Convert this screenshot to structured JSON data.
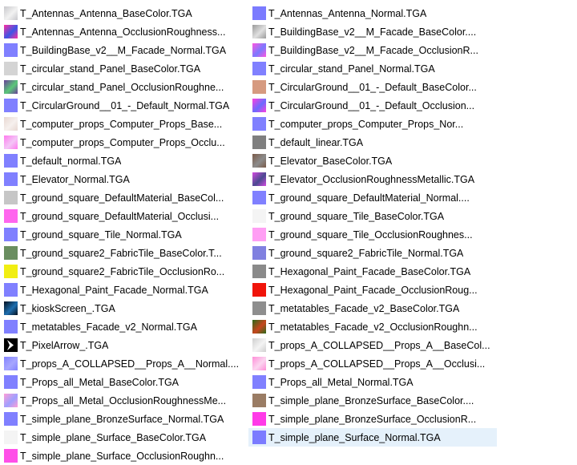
{
  "files": [
    {
      "name": "T_Antennas_Antenna_BaseColor.TGA",
      "thumb": {
        "kind": "mixed",
        "a": "#c8c8cc",
        "b": "#f2f2f2"
      }
    },
    {
      "name": "T_Antennas_Antenna_OcclusionRoughness...",
      "thumb": {
        "kind": "mixed",
        "a": "#ff2fa0",
        "b": "#3b55e6"
      }
    },
    {
      "name": "T_BuildingBase_v2__M_Facade_Normal.TGA",
      "thumb": {
        "kind": "solid",
        "a": "#8080ff"
      }
    },
    {
      "name": "T_circular_stand_Panel_BaseColor.TGA",
      "thumb": {
        "kind": "solid",
        "a": "#d4d4d4"
      }
    },
    {
      "name": "T_circular_stand_Panel_OcclusionRoughne...",
      "thumb": {
        "kind": "mixed",
        "a": "#6a3e9a",
        "b": "#59c978"
      }
    },
    {
      "name": "T_CircularGround__01_-_Default_Normal.TGA",
      "thumb": {
        "kind": "solid",
        "a": "#8080ff"
      }
    },
    {
      "name": "T_computer_props_Computer_Props_Base...",
      "thumb": {
        "kind": "mixed",
        "a": "#e8d8d2",
        "b": "#f6f0ee"
      }
    },
    {
      "name": "T_computer_props_Computer_Props_Occlu...",
      "thumb": {
        "kind": "mixed",
        "a": "#ff7aee",
        "b": "#f3c6f6"
      }
    },
    {
      "name": "T_default_normal.TGA",
      "thumb": {
        "kind": "solid",
        "a": "#8080ff"
      }
    },
    {
      "name": "T_Elevator_Normal.TGA",
      "thumb": {
        "kind": "solid",
        "a": "#8080ff"
      }
    },
    {
      "name": "T_ground_square_DefaultMaterial_BaseCol...",
      "thumb": {
        "kind": "solid",
        "a": "#c6c6c6"
      }
    },
    {
      "name": "T_ground_square_DefaultMaterial_Occlusi...",
      "thumb": {
        "kind": "solid",
        "a": "#ff66ee"
      }
    },
    {
      "name": "T_ground_square_Tile_Normal.TGA",
      "thumb": {
        "kind": "solid",
        "a": "#8080ff"
      }
    },
    {
      "name": "T_ground_square2_FabricTile_BaseColor.T...",
      "thumb": {
        "kind": "solid",
        "a": "#6a8e60"
      }
    },
    {
      "name": "T_ground_square2_FabricTile_OcclusionRo...",
      "thumb": {
        "kind": "solid",
        "a": "#f1ee12"
      }
    },
    {
      "name": "T_Hexagonal_Paint_Facade_Normal.TGA",
      "thumb": {
        "kind": "solid",
        "a": "#8080ff"
      }
    },
    {
      "name": "T_kioskScreen_.TGA",
      "thumb": {
        "kind": "mixed",
        "a": "#05101e",
        "b": "#1e6fb0"
      }
    },
    {
      "name": "T_metatables_Facade_v2_Normal.TGA",
      "thumb": {
        "kind": "solid",
        "a": "#8080ff"
      }
    },
    {
      "name": "T_PixelArrow_.TGA",
      "thumb": {
        "kind": "arrow",
        "a": "#000000",
        "b": "#ffffff"
      }
    },
    {
      "name": "T_props_A_COLLAPSED__Props_A__Normal....",
      "thumb": {
        "kind": "mixed",
        "a": "#8383ff",
        "b": "#a6a6ff"
      }
    },
    {
      "name": "T_Props_all_Metal_BaseColor.TGA",
      "thumb": {
        "kind": "solid",
        "a": "#8080ff"
      }
    },
    {
      "name": "T_Props_all_Metal_OcclusionRoughnessMe...",
      "thumb": {
        "kind": "mixed",
        "a": "#ff9ed6",
        "b": "#9fa0ff"
      }
    },
    {
      "name": "T_simple_plane_BronzeSurface_Normal.TGA",
      "thumb": {
        "kind": "solid",
        "a": "#8080ff"
      }
    },
    {
      "name": "T_simple_plane_Surface_BaseColor.TGA",
      "thumb": {
        "kind": "solid",
        "a": "#f4f4f4"
      }
    },
    {
      "name": "T_simple_plane_Surface_OcclusionRoughn...",
      "thumb": {
        "kind": "solid",
        "a": "#ff4fe8"
      }
    },
    {
      "name": "T_Antennas_Antenna_Normal.TGA",
      "thumb": {
        "kind": "solid",
        "a": "#7b7bff"
      }
    },
    {
      "name": "T_BuildingBase_v2__M_Facade_BaseColor....",
      "thumb": {
        "kind": "mixed",
        "a": "#9a9a9a",
        "b": "#e0e0e0"
      }
    },
    {
      "name": "T_BuildingBase_v2__M_Facade_OcclusionR...",
      "thumb": {
        "kind": "mixed",
        "a": "#ff55e0",
        "b": "#7a7aff"
      }
    },
    {
      "name": "T_circular_stand_Panel_Normal.TGA",
      "thumb": {
        "kind": "solid",
        "a": "#8080ff"
      }
    },
    {
      "name": "T_CircularGround__01_-_Default_BaseColor...",
      "thumb": {
        "kind": "solid",
        "a": "#d69a80"
      }
    },
    {
      "name": "T_CircularGround__01_-_Default_Occlusion...",
      "thumb": {
        "kind": "mixed",
        "a": "#ff3fe0",
        "b": "#6b6bff"
      }
    },
    {
      "name": "T_computer_props_Computer_Props_Nor...",
      "thumb": {
        "kind": "solid",
        "a": "#8080ff"
      }
    },
    {
      "name": "T_default_linear.TGA",
      "thumb": {
        "kind": "solid",
        "a": "#7f7f7f"
      }
    },
    {
      "name": "T_Elevator_BaseColor.TGA",
      "thumb": {
        "kind": "mixed",
        "a": "#7a5a48",
        "b": "#8c8c8c"
      }
    },
    {
      "name": "T_Elevator_OcclusionRoughnessMetallic.TGA",
      "thumb": {
        "kind": "mixed",
        "a": "#d44ae0",
        "b": "#4a4a90"
      }
    },
    {
      "name": "T_ground_square_DefaultMaterial_Normal....",
      "thumb": {
        "kind": "solid",
        "a": "#8080ff"
      }
    },
    {
      "name": "T_ground_square_Tile_BaseColor.TGA",
      "thumb": {
        "kind": "solid",
        "a": "#f4f4f4"
      }
    },
    {
      "name": "T_ground_square_Tile_OcclusionRoughnes...",
      "thumb": {
        "kind": "solid",
        "a": "#ff9ef4"
      }
    },
    {
      "name": "T_ground_square2_FabricTile_Normal.TGA",
      "thumb": {
        "kind": "solid",
        "a": "#8080e0"
      }
    },
    {
      "name": "T_Hexagonal_Paint_Facade_BaseColor.TGA",
      "thumb": {
        "kind": "solid",
        "a": "#8a8a8a"
      }
    },
    {
      "name": "T_Hexagonal_Paint_Facade_OcclusionRoug...",
      "thumb": {
        "kind": "solid",
        "a": "#f0140a"
      }
    },
    {
      "name": "T_metatables_Facade_v2_BaseColor.TGA",
      "thumb": {
        "kind": "solid",
        "a": "#8e8e8e"
      }
    },
    {
      "name": "T_metatables_Facade_v2_OcclusionRoughn...",
      "thumb": {
        "kind": "mixed",
        "a": "#2a6a1a",
        "b": "#c8461e"
      }
    },
    {
      "name": "T_props_A_COLLAPSED__Props_A__BaseCol...",
      "thumb": {
        "kind": "mixed",
        "a": "#cfcfcf",
        "b": "#f4f4f4"
      }
    },
    {
      "name": "T_props_A_COLLAPSED__Props_A__Occlusi...",
      "thumb": {
        "kind": "mixed",
        "a": "#ff8ed8",
        "b": "#fbd6f0"
      }
    },
    {
      "name": "T_Props_all_Metal_Normal.TGA",
      "thumb": {
        "kind": "solid",
        "a": "#8080ff"
      }
    },
    {
      "name": "T_simple_plane_BronzeSurface_BaseColor....",
      "thumb": {
        "kind": "solid",
        "a": "#9a7c64"
      }
    },
    {
      "name": "T_simple_plane_BronzeSurface_OcclusionR...",
      "thumb": {
        "kind": "solid",
        "a": "#ff3ae8"
      }
    },
    {
      "name": "T_simple_plane_Surface_Normal.TGA",
      "thumb": {
        "kind": "solid",
        "a": "#7b7bff"
      },
      "selected": true
    }
  ]
}
